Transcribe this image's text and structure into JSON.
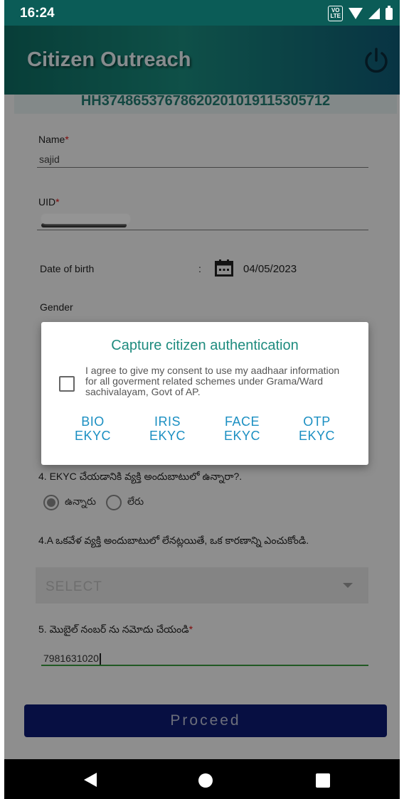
{
  "status_bar": {
    "time": "16:24",
    "volte_top": "VO",
    "volte_bottom": "LTE",
    "icons": [
      "volte-icon",
      "wifi-icon",
      "signal-icon",
      "battery-icon"
    ]
  },
  "app_bar": {
    "title": "Citizen Outreach",
    "icon": "power-icon"
  },
  "id_strip": "HH37486537678620201019115305712",
  "form": {
    "name_label": "Name",
    "name_required": "*",
    "name_value": "sajid",
    "uid_label": "UID",
    "uid_required": "*",
    "dob_label": "Date of birth",
    "dob_separator": ":",
    "dob_value": "04/05/2023",
    "gender_label": "Gender",
    "q4_label": "4. EKYC చేయడానికి వ్యక్తి అందుబాటులో ఉన్నారా?.",
    "q4_options": [
      "ఉన్నారు",
      "లేరు"
    ],
    "q4a_label": "4.A ఒకవేళ వ్యక్తి అందుబాటులో లేనట్లయితే, ఒక కారణాన్ని ఎంచుకోండి.",
    "select_placeholder": "SELECT",
    "q5_label": "5. మొబైల్ నంబర్ ను నమోదు చేయండి",
    "q5_required": "*",
    "mobile_value": "7981631020",
    "proceed_label": "Proceed"
  },
  "dialog": {
    "title": "Capture citizen authentication",
    "consent_text": "I agree to give my consent to use my aadhaar information for all goverment related schemes under Grama/Ward sachivalayam, Govt of AP.",
    "buttons": [
      {
        "line1": "BIO",
        "line2": "EKYC"
      },
      {
        "line1": "IRIS",
        "line2": "EKYC"
      },
      {
        "line1": "FACE",
        "line2": "EKYC"
      },
      {
        "line1": "OTP",
        "line2": "EKYC"
      }
    ]
  },
  "colors": {
    "primary_teal": "#0e6b61",
    "accent_teal": "#1e8b7e",
    "button_blue": "#1b8fc2",
    "proceed_navy": "#0d1a72",
    "required_red": "#d11111",
    "input_green": "#3a9a3f"
  }
}
